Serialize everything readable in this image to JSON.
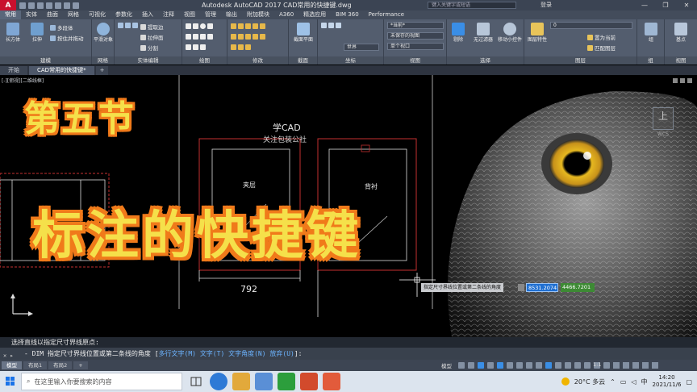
{
  "window": {
    "app_logo": "A",
    "title": "Autodesk AutoCAD 2017    CAD常用的快捷键.dwg",
    "search_placeholder": "键入关键字或短语",
    "login": "登录",
    "controls": [
      "—",
      "❐",
      "✕"
    ]
  },
  "ribbon_tabs": [
    "常用",
    "实体",
    "曲面",
    "网格",
    "可视化",
    "参数化",
    "插入",
    "注释",
    "视图",
    "管理",
    "输出",
    "附加模块",
    "A360",
    "精选应用",
    "BIM 360",
    "Performance"
  ],
  "ribbon": {
    "panels": [
      {
        "title": "建模",
        "buttons": [
          "长方体",
          "拉伸"
        ],
        "small": [
          "多段体",
          "按住并拖动"
        ]
      },
      {
        "title": "网格",
        "buttons": [
          "平滑对象"
        ]
      },
      {
        "title": "实体编辑",
        "small": [
          "提取边",
          "拉伸面",
          "分割"
        ]
      },
      {
        "title": "绘图"
      },
      {
        "title": "修改"
      },
      {
        "title": "截面",
        "buttons": [
          "截面平面"
        ]
      },
      {
        "title": "坐标",
        "combos": [
          "世界"
        ]
      },
      {
        "title": "视图",
        "combos": [
          "*当前*",
          "未保存的视图",
          "单个视口"
        ]
      },
      {
        "title": "选择",
        "buttons": [
          "剔除",
          "无过滤器",
          "移动小控件"
        ]
      },
      {
        "title": "图层",
        "buttons": [
          "图层特性"
        ],
        "small": [
          "置为当前",
          "匹配图层"
        ],
        "combos": [
          "0"
        ]
      },
      {
        "title": "组",
        "buttons": [
          "组"
        ]
      },
      {
        "title": "视图",
        "buttons": [
          "基点"
        ]
      }
    ]
  },
  "file_tabs": [
    "开始",
    "CAD常用的快捷键*",
    "+"
  ],
  "drawing": {
    "viewport_label": "[-][俯视][二维线框]",
    "title_line_1": "第五节",
    "title_line_2": "标注的快捷键",
    "watermark_1": "学CAD",
    "watermark_2": "关注包装公社",
    "label_left": "夹层",
    "label_right": "背衬",
    "dimension": "792",
    "dynamic_prompt": "指定尺寸界线位置或第二条线的角度",
    "dynamic_value_1": "8531.2074",
    "dynamic_value_2": "4466.7201",
    "navcube_label": "上",
    "navcube_sub": "WCS"
  },
  "command": {
    "history": "选择直线以指定尺寸界线原点:",
    "prompt_prefix": "- DIM 指定尺寸界线位置或第二条线的角度 [",
    "opt1": "多行文字(M)",
    "opt2": "文字(T)",
    "opt3": "文字角度(N)",
    "opt4": "放弃(U)",
    "prompt_suffix": "]:"
  },
  "layout_tabs": [
    "模型",
    "布局1",
    "布局2",
    "+"
  ],
  "statusbar": {
    "mode": "模型",
    "scale": "1:1"
  },
  "taskbar": {
    "search_placeholder": "在这里输入你要搜索的内容",
    "weather": "20°C 多云",
    "time": "14:20",
    "date": "2021/11/6",
    "ime": "中"
  }
}
